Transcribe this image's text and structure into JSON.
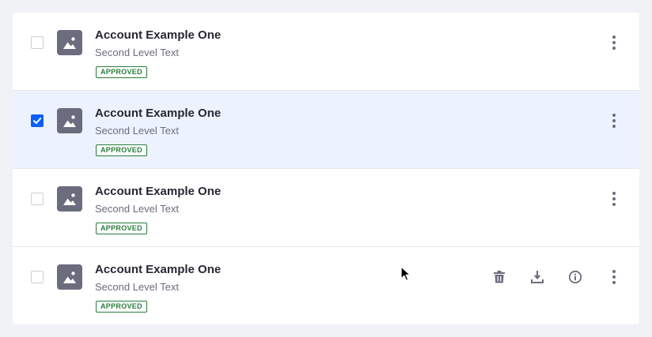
{
  "rows": [
    {
      "title": "Account Example One",
      "subtitle": "Second Level Text",
      "status": "APPROVED",
      "checked": false
    },
    {
      "title": "Account Example One",
      "subtitle": "Second Level Text",
      "status": "APPROVED",
      "checked": true
    },
    {
      "title": "Account Example One",
      "subtitle": "Second Level Text",
      "status": "APPROVED",
      "checked": false
    },
    {
      "title": "Account Example One",
      "subtitle": "Second Level Text",
      "status": "APPROVED",
      "checked": false
    }
  ],
  "quick_actions": [
    "trash-icon",
    "download-icon",
    "info-icon"
  ],
  "colors": {
    "accent": "#0b5fff",
    "selected_row": "#edf3fe",
    "badge": "#287d3c",
    "icon": "#6b6c7e"
  }
}
